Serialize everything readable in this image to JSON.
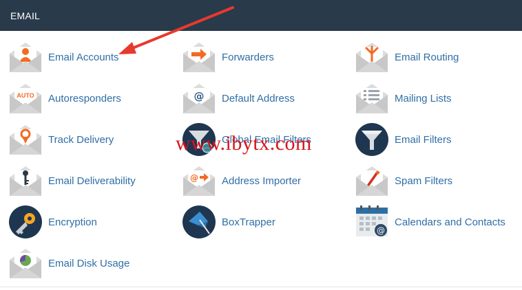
{
  "panel": {
    "title": "EMAIL"
  },
  "items": [
    {
      "label": "Email Accounts",
      "icon": "email-accounts-icon"
    },
    {
      "label": "Forwarders",
      "icon": "forwarders-icon"
    },
    {
      "label": "Email Routing",
      "icon": "email-routing-icon"
    },
    {
      "label": "Autoresponders",
      "icon": "autoresponders-icon"
    },
    {
      "label": "Default Address",
      "icon": "default-address-icon"
    },
    {
      "label": "Mailing Lists",
      "icon": "mailing-lists-icon"
    },
    {
      "label": "Track Delivery",
      "icon": "track-delivery-icon"
    },
    {
      "label": "Global Email Filters",
      "icon": "global-email-filters-icon"
    },
    {
      "label": "Email Filters",
      "icon": "email-filters-icon"
    },
    {
      "label": "Email Deliverability",
      "icon": "email-deliverability-icon"
    },
    {
      "label": "Address Importer",
      "icon": "address-importer-icon"
    },
    {
      "label": "Spam Filters",
      "icon": "spam-filters-icon"
    },
    {
      "label": "Encryption",
      "icon": "encryption-icon"
    },
    {
      "label": "BoxTrapper",
      "icon": "boxtrapper-icon"
    },
    {
      "label": "Calendars and Contacts",
      "icon": "calendars-contacts-icon"
    },
    {
      "label": "Email Disk Usage",
      "icon": "email-disk-usage-icon"
    }
  ],
  "auto_badge": "AUTO",
  "watermark": "www.ibytx.com",
  "colors": {
    "header_bg": "#293a4a",
    "link": "#2f6ea6",
    "accent": "#f26b21",
    "annotation": "#e8392f"
  }
}
